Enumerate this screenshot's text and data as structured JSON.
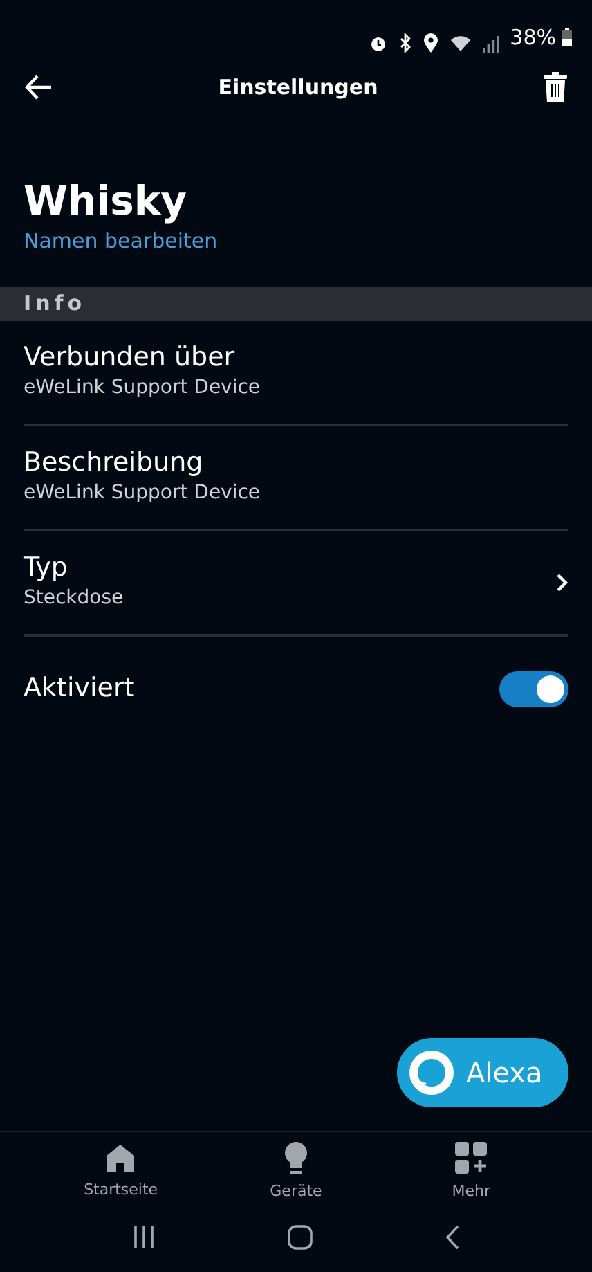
{
  "status_bar": {
    "battery": "38%"
  },
  "header": {
    "title": "Einstellungen"
  },
  "device": {
    "name": "Whisky",
    "edit_link": "Namen bearbeiten"
  },
  "section": {
    "title": "Info"
  },
  "rows": [
    {
      "kind": "text",
      "label": "Verbunden über",
      "value": "eWeLink Support Device"
    },
    {
      "kind": "text",
      "label": "Beschreibung",
      "value": "eWeLink Support Device"
    },
    {
      "kind": "link",
      "label": "Typ",
      "value": "Steckdose"
    },
    {
      "kind": "toggle",
      "label": "Aktiviert",
      "on": true
    }
  ],
  "alexa_button": {
    "label": "Alexa"
  },
  "bottom_nav": [
    {
      "label": "Startseite"
    },
    {
      "label": "Geräte"
    },
    {
      "label": "Mehr"
    }
  ]
}
